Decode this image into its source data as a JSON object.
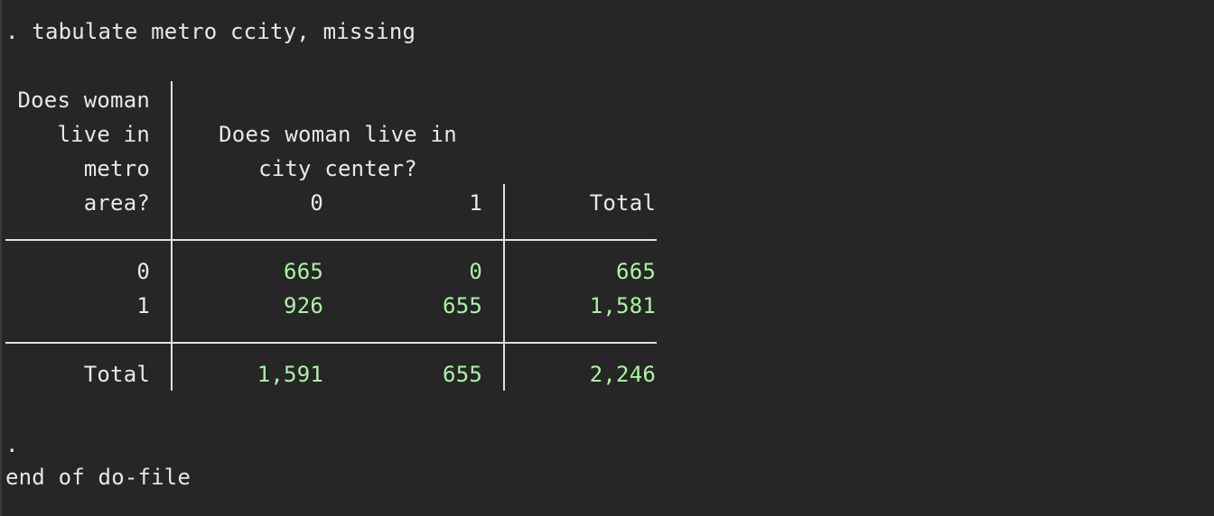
{
  "command": ". tabulate metro ccity, missing",
  "table": {
    "row_header_lines": [
      "Does woman",
      "live in",
      "metro",
      "area?"
    ],
    "col_header_lines": [
      "Does woman live in",
      "city center?"
    ],
    "columns": [
      "0",
      "1",
      "Total"
    ],
    "rows": [
      {
        "label": "0",
        "values": [
          "665",
          "0",
          "665"
        ]
      },
      {
        "label": "1",
        "values": [
          "926",
          "655",
          "1,581"
        ]
      }
    ],
    "total_row": {
      "label": "Total",
      "values": [
        "1,591",
        "655",
        "2,246"
      ]
    }
  },
  "prompt_dot": ".",
  "end_message": "end of do-file",
  "colors": {
    "background": "#262626",
    "text": "#e8e8e8",
    "numbers": "#a9f5a1",
    "rules": "#e0e0e0"
  }
}
